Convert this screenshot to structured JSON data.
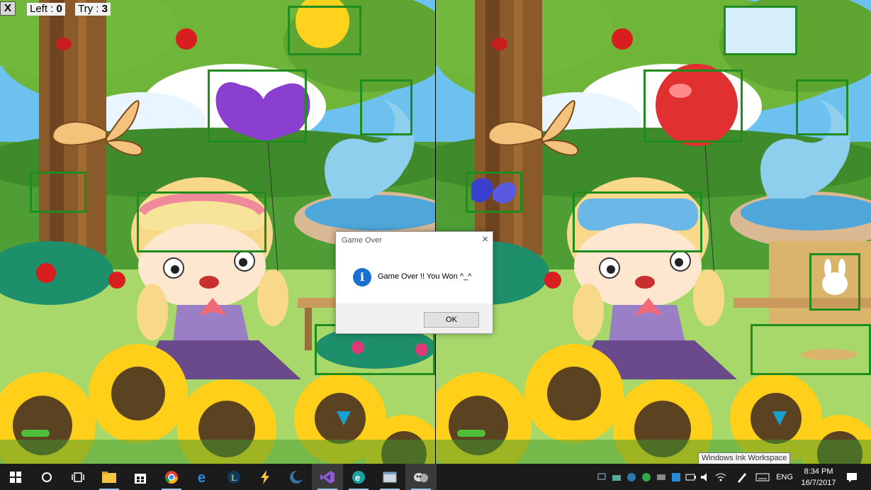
{
  "hud": {
    "close_label": "X",
    "left_label": "Left : ",
    "left_value": "0",
    "try_label": "Try : ",
    "try_value": "3"
  },
  "dialog": {
    "title": "Game Over",
    "message": "Game Over !! You Won ^_^",
    "ok_label": "OK",
    "close_glyph": "×",
    "icon": "info-icon"
  },
  "tooltip": {
    "text": "Windows Ink Workspace"
  },
  "taskbar": {
    "apps": [
      {
        "name": "start-icon"
      },
      {
        "name": "cortana-icon"
      },
      {
        "name": "task-view-icon"
      },
      {
        "name": "file-explorer-icon"
      },
      {
        "name": "store-icon"
      },
      {
        "name": "chrome-icon"
      },
      {
        "name": "edge-icon"
      },
      {
        "name": "league-icon"
      },
      {
        "name": "bolt-icon"
      },
      {
        "name": "app-moon-icon"
      },
      {
        "name": "visual-studio-icon"
      },
      {
        "name": "e-app-icon"
      },
      {
        "name": "window-app-icon"
      },
      {
        "name": "game-app-icon"
      }
    ],
    "language": "ENG",
    "time": "8:34 PM",
    "date": "16/7/2017"
  },
  "colors": {
    "highlight": "#1e8c1e",
    "taskbar": "#1b1b1b",
    "sky": "#6cc1ee",
    "grass": "#7cc24a",
    "balloon_left": "#8a3fd0",
    "balloon_right": "#e03030"
  }
}
